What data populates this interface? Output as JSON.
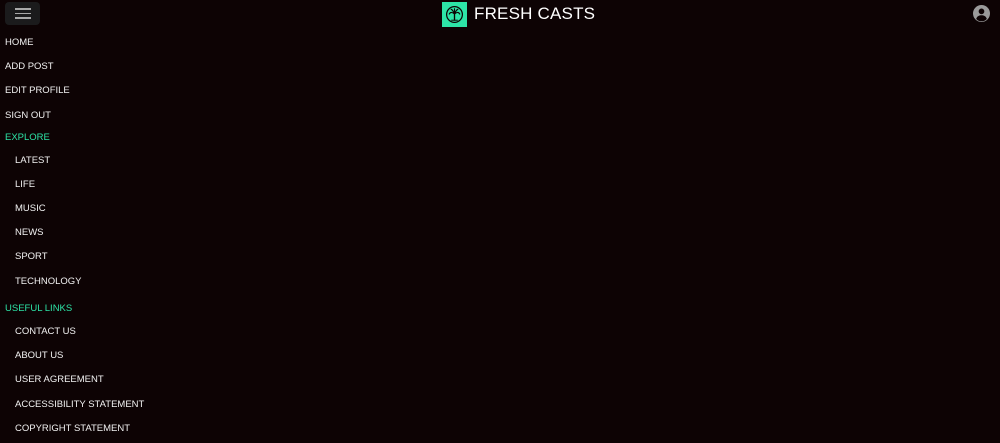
{
  "header": {
    "brand_name": "FRESH CASTS",
    "menu_icon": "hamburger-menu-icon",
    "logo_icon": "palm-tree-logo-icon",
    "account_icon": "account-circle-icon",
    "accent_color": "#2de4a7",
    "background_color": "#0d0304"
  },
  "nav": {
    "main": [
      {
        "label": "HOME"
      },
      {
        "label": "ADD POST"
      },
      {
        "label": "EDIT PROFILE"
      },
      {
        "label": "SIGN OUT"
      }
    ],
    "explore_heading": "EXPLORE",
    "explore": [
      {
        "label": "LATEST"
      },
      {
        "label": "LIFE"
      },
      {
        "label": "MUSIC"
      },
      {
        "label": "NEWS"
      },
      {
        "label": "SPORT"
      },
      {
        "label": "TECHNOLOGY"
      }
    ],
    "useful_links_heading": "USEFUL LINKS",
    "useful_links": [
      {
        "label": "CONTACT US"
      },
      {
        "label": "ABOUT US"
      },
      {
        "label": "USER AGREEMENT"
      },
      {
        "label": "ACCESSIBILITY STATEMENT"
      },
      {
        "label": "COPYRIGHT STATEMENT"
      }
    ]
  }
}
